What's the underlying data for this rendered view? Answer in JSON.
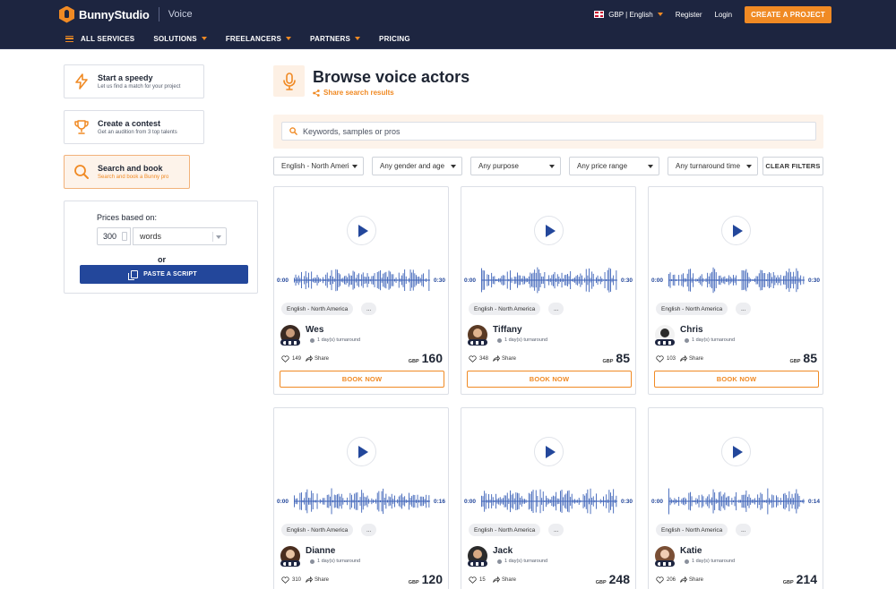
{
  "header": {
    "brand": "BunnyStudio",
    "section": "Voice",
    "currency_language": "GBP | English",
    "register": "Register",
    "login": "Login",
    "cta": "CREATE A PROJECT",
    "nav": [
      {
        "label": "ALL SERVICES"
      },
      {
        "label": "SOLUTIONS"
      },
      {
        "label": "FREELANCERS"
      },
      {
        "label": "PARTNERS"
      },
      {
        "label": "PRICING"
      }
    ]
  },
  "sidebar": {
    "options": [
      {
        "title": "Start a speedy",
        "subtitle": "Let us find a match for your project",
        "icon": "lightning-icon"
      },
      {
        "title": "Create a contest",
        "subtitle": "Get an audition from 3 top talents",
        "icon": "trophy-icon"
      },
      {
        "title": "Search and book",
        "subtitle": "Search and book a Bunny pro",
        "icon": "search-icon"
      }
    ],
    "prices_label": "Prices based on:",
    "word_count": "300",
    "unit": "words",
    "or": "or",
    "paste_script": "PASTE A SCRIPT"
  },
  "main": {
    "title": "Browse voice actors",
    "share_results": "Share search results",
    "search_placeholder": "Keywords, samples or pros",
    "filters": [
      "English - North Ameri",
      "Any gender and age",
      "Any purpose",
      "Any price range",
      "Any turnaround time"
    ],
    "clear_filters": "CLEAR FILTERS"
  },
  "cards": [
    {
      "name": "Wes",
      "duration_start": "0:00",
      "duration_end": "0:30",
      "language": "English - North America",
      "more": "...",
      "turnaround": "1 day(s) turnaround",
      "likes": "149",
      "share": "Share",
      "currency": "GBP",
      "price": "160",
      "book": "BOOK NOW"
    },
    {
      "name": "Tiffany",
      "duration_start": "0:00",
      "duration_end": "0:30",
      "language": "English - North America",
      "more": "...",
      "turnaround": "1 day(s) turnaround",
      "likes": "348",
      "share": "Share",
      "currency": "GBP",
      "price": "85",
      "book": "BOOK NOW"
    },
    {
      "name": "Chris",
      "duration_start": "0:00",
      "duration_end": "0:30",
      "language": "English - North America",
      "more": "...",
      "turnaround": "1 day(s) turnaround",
      "likes": "103",
      "share": "Share",
      "currency": "GBP",
      "price": "85",
      "book": "BOOK NOW"
    },
    {
      "name": "Dianne",
      "duration_start": "0:00",
      "duration_end": "0:16",
      "language": "English - North America",
      "more": "...",
      "turnaround": "1 day(s) turnaround",
      "likes": "310",
      "share": "Share",
      "currency": "GBP",
      "price": "120",
      "book": "BOOK NOW"
    },
    {
      "name": "Jack",
      "duration_start": "0:00",
      "duration_end": "0:30",
      "language": "English - North America",
      "more": "...",
      "turnaround": "1 day(s) turnaround",
      "likes": "15",
      "share": "Share",
      "currency": "GBP",
      "price": "248",
      "book": "BOOK NOW"
    },
    {
      "name": "Katie",
      "duration_start": "0:00",
      "duration_end": "0:14",
      "language": "English - North America",
      "more": "...",
      "turnaround": "1 day(s) turnaround",
      "likes": "206",
      "share": "Share",
      "currency": "GBP",
      "price": "214",
      "book": "BOOK NOW"
    }
  ],
  "colors": {
    "navy": "#1d2540",
    "accent_orange": "#f08a24",
    "accent_blue": "#23479b",
    "peach_bg": "#fdf3ea"
  }
}
